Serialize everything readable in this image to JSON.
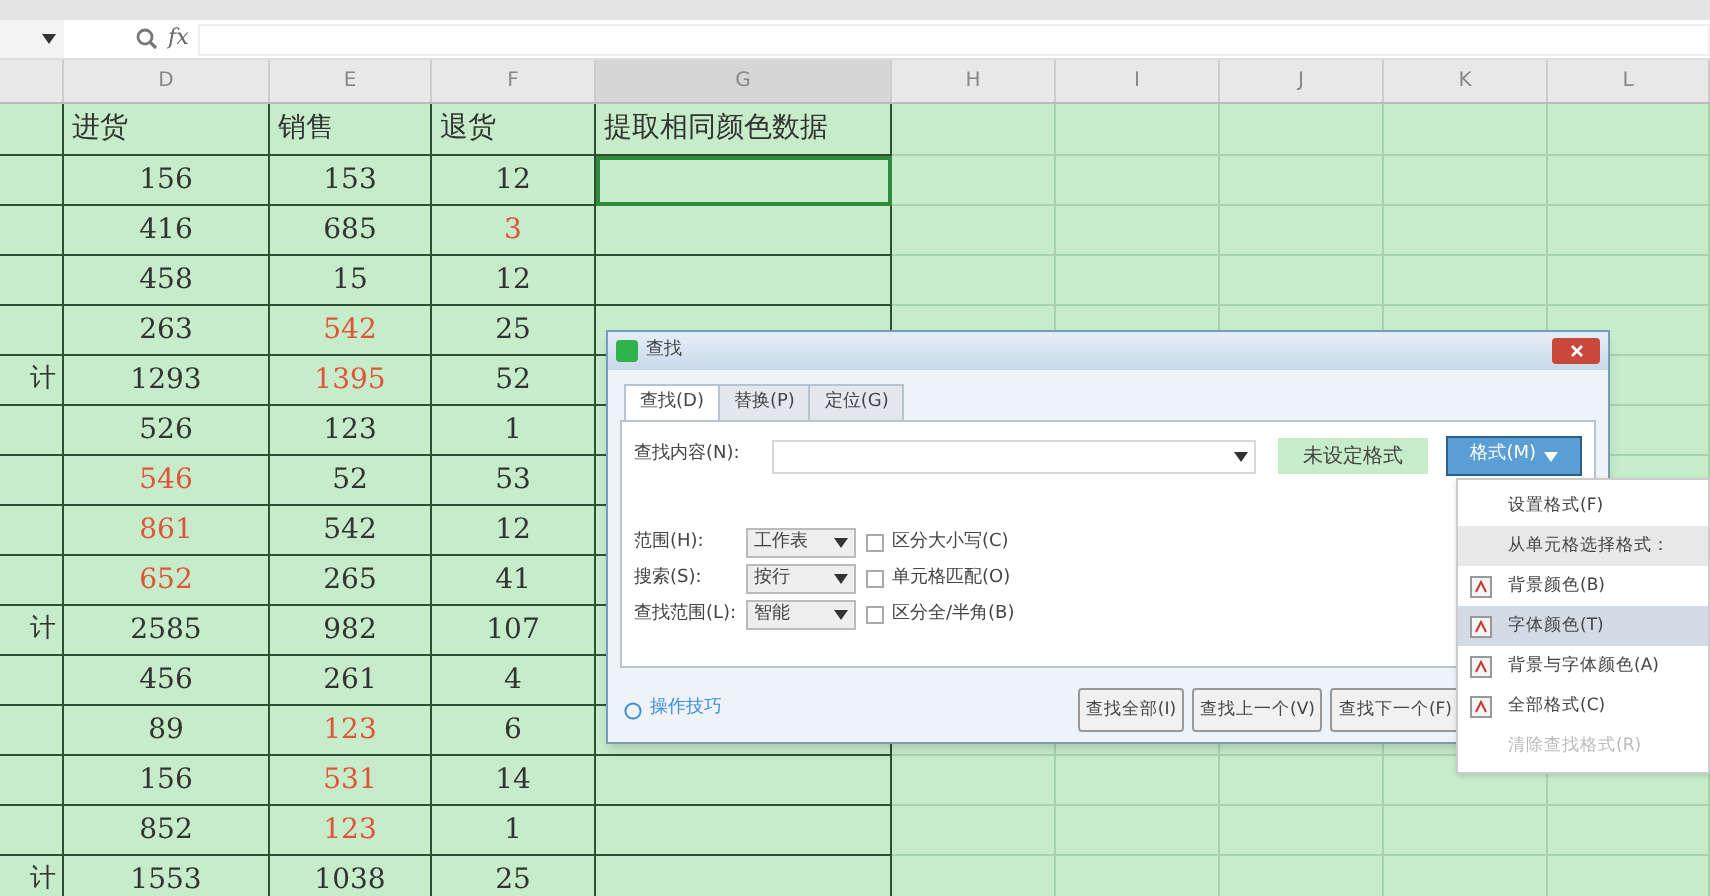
{
  "formula_bar": {
    "fx": "fx"
  },
  "columns": [
    "D",
    "E",
    "F",
    "G",
    "H",
    "I",
    "J",
    "K",
    "L"
  ],
  "header_row": [
    "进货",
    "销售",
    "退货",
    "提取相同颜色数据"
  ],
  "rows": [
    {
      "selected": true,
      "cells": [
        {
          "text": "156",
          "color": "#333333"
        },
        {
          "text": "153",
          "color": "#333333"
        },
        {
          "text": "12",
          "color": "#333333"
        }
      ]
    },
    {
      "selected": false,
      "cells": [
        {
          "text": "416",
          "color": "#333333"
        },
        {
          "text": "685",
          "color": "#333333"
        },
        {
          "text": "3",
          "color": "#e0553a"
        }
      ]
    },
    {
      "selected": false,
      "cells": [
        {
          "text": "458",
          "color": "#333333"
        },
        {
          "text": "15",
          "color": "#333333"
        },
        {
          "text": "12",
          "color": "#333333"
        }
      ]
    },
    {
      "selected": false,
      "cells": [
        {
          "text": "263",
          "color": "#333333"
        },
        {
          "text": "542",
          "color": "#e0553a"
        },
        {
          "text": "25",
          "color": "#333333"
        }
      ]
    },
    {
      "selected": false,
      "label": "计",
      "cells": [
        {
          "text": "1293",
          "color": "#333333"
        },
        {
          "text": "1395",
          "color": "#e0553a"
        },
        {
          "text": "52",
          "color": "#333333"
        }
      ]
    },
    {
      "selected": false,
      "cells": [
        {
          "text": "526",
          "color": "#333333"
        },
        {
          "text": "123",
          "color": "#333333"
        },
        {
          "text": "1",
          "color": "#333333"
        }
      ]
    },
    {
      "selected": false,
      "cells": [
        {
          "text": "546",
          "color": "#e0553a"
        },
        {
          "text": "52",
          "color": "#333333"
        },
        {
          "text": "53",
          "color": "#333333"
        }
      ]
    },
    {
      "selected": false,
      "cells": [
        {
          "text": "861",
          "color": "#e0553a"
        },
        {
          "text": "542",
          "color": "#333333"
        },
        {
          "text": "12",
          "color": "#333333"
        }
      ]
    },
    {
      "selected": false,
      "cells": [
        {
          "text": "652",
          "color": "#e0553a"
        },
        {
          "text": "265",
          "color": "#333333"
        },
        {
          "text": "41",
          "color": "#333333"
        }
      ]
    },
    {
      "selected": false,
      "label": "计",
      "cells": [
        {
          "text": "2585",
          "color": "#333333"
        },
        {
          "text": "982",
          "color": "#333333"
        },
        {
          "text": "107",
          "color": "#333333"
        }
      ]
    },
    {
      "selected": false,
      "cells": [
        {
          "text": "456",
          "color": "#333333"
        },
        {
          "text": "261",
          "color": "#333333"
        },
        {
          "text": "4",
          "color": "#333333"
        }
      ]
    },
    {
      "selected": false,
      "cells": [
        {
          "text": "89",
          "color": "#333333"
        },
        {
          "text": "123",
          "color": "#e0553a"
        },
        {
          "text": "6",
          "color": "#333333"
        }
      ]
    },
    {
      "selected": false,
      "cells": [
        {
          "text": "156",
          "color": "#333333"
        },
        {
          "text": "531",
          "color": "#e0553a"
        },
        {
          "text": "14",
          "color": "#333333"
        }
      ]
    },
    {
      "selected": false,
      "cells": [
        {
          "text": "852",
          "color": "#333333"
        },
        {
          "text": "123",
          "color": "#e0553a"
        },
        {
          "text": "1",
          "color": "#333333"
        }
      ]
    },
    {
      "selected": false,
      "label": "计",
      "cells": [
        {
          "text": "1553",
          "color": "#333333"
        },
        {
          "text": "1038",
          "color": "#333333"
        },
        {
          "text": "25",
          "color": "#333333"
        }
      ]
    }
  ],
  "dialog": {
    "title": "查找",
    "tabs": [
      {
        "label": "查找(D)",
        "selected": true
      },
      {
        "label": "替换(P)",
        "selected": false
      },
      {
        "label": "定位(G)",
        "selected": false
      }
    ],
    "find_label": "查找内容(N):",
    "format_status": "未设定格式",
    "format_button": "格式(M)",
    "options": [
      {
        "label": "范围(H):",
        "value": "工作表",
        "checkbox": "区分大小写(C)",
        "checked": false
      },
      {
        "label": "搜索(S):",
        "value": "按行",
        "checkbox": "单元格匹配(O)",
        "checked": false
      },
      {
        "label": "查找范围(L):",
        "value": "智能",
        "checkbox": "区分全/半角(B)",
        "checked": false
      }
    ],
    "tips_link": "操作技巧",
    "buttons": [
      "查找全部(I)",
      "查找上一个(V)",
      "查找下一个(F)"
    ]
  },
  "format_menu": [
    {
      "kind": "plain",
      "label": "设置格式(F)",
      "selected": false,
      "disabled": false
    },
    {
      "kind": "header",
      "label": "从单元格选择格式：",
      "selected": false,
      "disabled": false
    },
    {
      "kind": "icon",
      "label": "背景颜色(B)",
      "selected": false,
      "disabled": false
    },
    {
      "kind": "icon",
      "label": "字体颜色(T)",
      "selected": true,
      "disabled": false
    },
    {
      "kind": "icon",
      "label": "背景与字体颜色(A)",
      "selected": false,
      "disabled": false
    },
    {
      "kind": "icon",
      "label": "全部格式(C)",
      "selected": false,
      "disabled": false
    },
    {
      "kind": "plain",
      "label": "清除查找格式(R)",
      "selected": false,
      "disabled": true
    }
  ]
}
